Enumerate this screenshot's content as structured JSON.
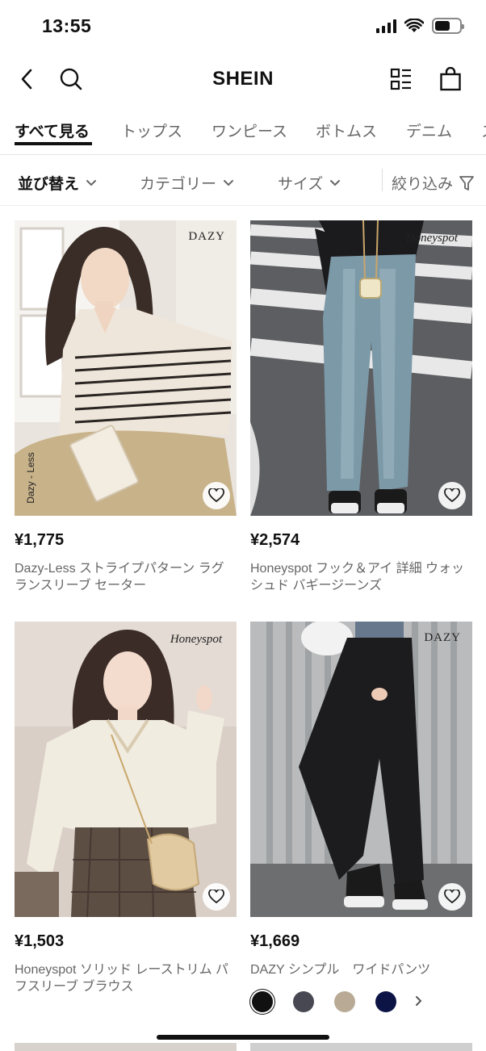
{
  "status_bar": {
    "time": "13:55"
  },
  "nav": {
    "brand": "SHEIN"
  },
  "tabs": [
    {
      "label": "すべて見る"
    },
    {
      "label": "トップス"
    },
    {
      "label": "ワンピース"
    },
    {
      "label": "ボトムス"
    },
    {
      "label": "デニム"
    },
    {
      "label": "ス"
    }
  ],
  "filters": {
    "sort": "並び替え",
    "category": "カテゴリー",
    "size": "サイズ",
    "refine": "絞り込み"
  },
  "products": [
    {
      "brand_mark": "DAZY",
      "side_mark": "Dazy - Less",
      "price": "¥1,775",
      "title": "Dazy-Less ストライプパターン ラグランスリーブ セーター"
    },
    {
      "brand_mark": "Honeyspot",
      "price": "¥2,574",
      "title": "Honeyspot フック＆アイ 詳細 ウォッシュド バギージーンズ"
    },
    {
      "brand_mark": "Honeyspot",
      "price": "¥1,503",
      "title": "Honeyspot ソリッド レーストリム パフスリーブ ブラウス"
    },
    {
      "brand_mark": "DAZY",
      "price": "¥1,669",
      "title": "DAZY シンプル　ワイドパンツ"
    }
  ],
  "swatch_colors": [
    "#111111",
    "#474852",
    "#b8aa95",
    "#0c1446"
  ],
  "colors": {
    "accent": "#111111",
    "muted_text": "#666666"
  }
}
